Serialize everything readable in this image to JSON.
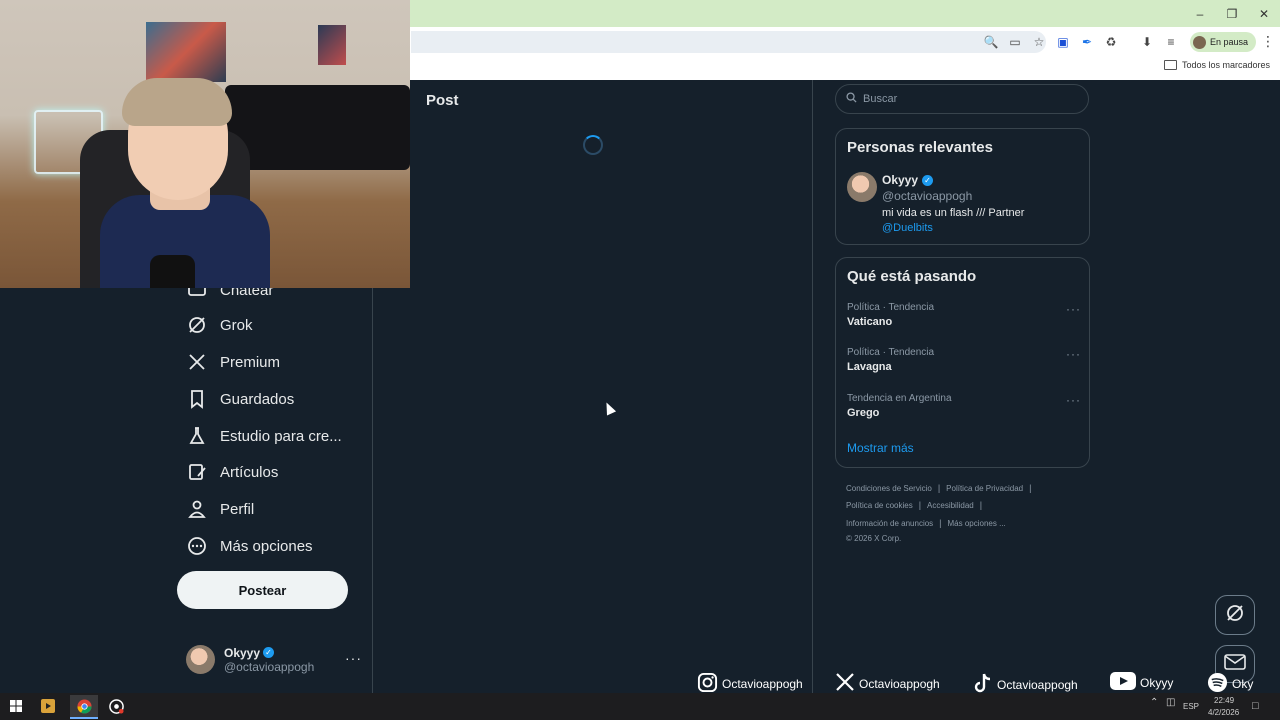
{
  "browser": {
    "pause_label": "En pausa",
    "bookmarks_label": "Todos los marcadores"
  },
  "nav": {
    "partial_label": "Chatear",
    "items": [
      {
        "label": "Grok"
      },
      {
        "label": "Premium"
      },
      {
        "label": "Guardados"
      },
      {
        "label": "Estudio para cre..."
      },
      {
        "label": "Artículos"
      },
      {
        "label": "Perfil"
      },
      {
        "label": "Más opciones"
      }
    ],
    "post_button": "Postear"
  },
  "account": {
    "name": "Okyyy",
    "handle": "@octavioappogh"
  },
  "main": {
    "title": "Post"
  },
  "search": {
    "placeholder": "Buscar"
  },
  "relevant": {
    "title": "Personas relevantes",
    "name": "Okyyy",
    "handle": "@octavioappogh",
    "bio": "mi vida es un flash /// Partner",
    "bio_link": "@Duelbits"
  },
  "trends": {
    "title": "Qué está pasando",
    "items": [
      {
        "meta": "Política · Tendencia",
        "name": "Vaticano"
      },
      {
        "meta": "Política · Tendencia",
        "name": "Lavagna"
      },
      {
        "meta": "Tendencia en Argentina",
        "name": "Grego"
      }
    ],
    "show_more": "Mostrar más"
  },
  "footer": {
    "links": [
      "Condiciones de Servicio",
      "Política de Privacidad",
      "Política de cookies",
      "Accesibilidad",
      "Información de anuncios",
      "Más opciones ..."
    ],
    "copyright": "© 2026 X Corp."
  },
  "socials": [
    {
      "icon": "instagram-icon",
      "label": "Octavioappogh"
    },
    {
      "icon": "x-icon",
      "label": "Octavioappogh"
    },
    {
      "icon": "tiktok-icon",
      "label": "Octavioappogh"
    },
    {
      "icon": "youtube-icon",
      "label": "Okyyy"
    },
    {
      "icon": "spotify-icon",
      "label": "Oky"
    }
  ],
  "taskbar": {
    "language": "ESP",
    "time": "22:49",
    "date": "4/2/2026"
  },
  "colors": {
    "background": "#15202b",
    "accent": "#1d9bf0",
    "border": "#38444d"
  }
}
